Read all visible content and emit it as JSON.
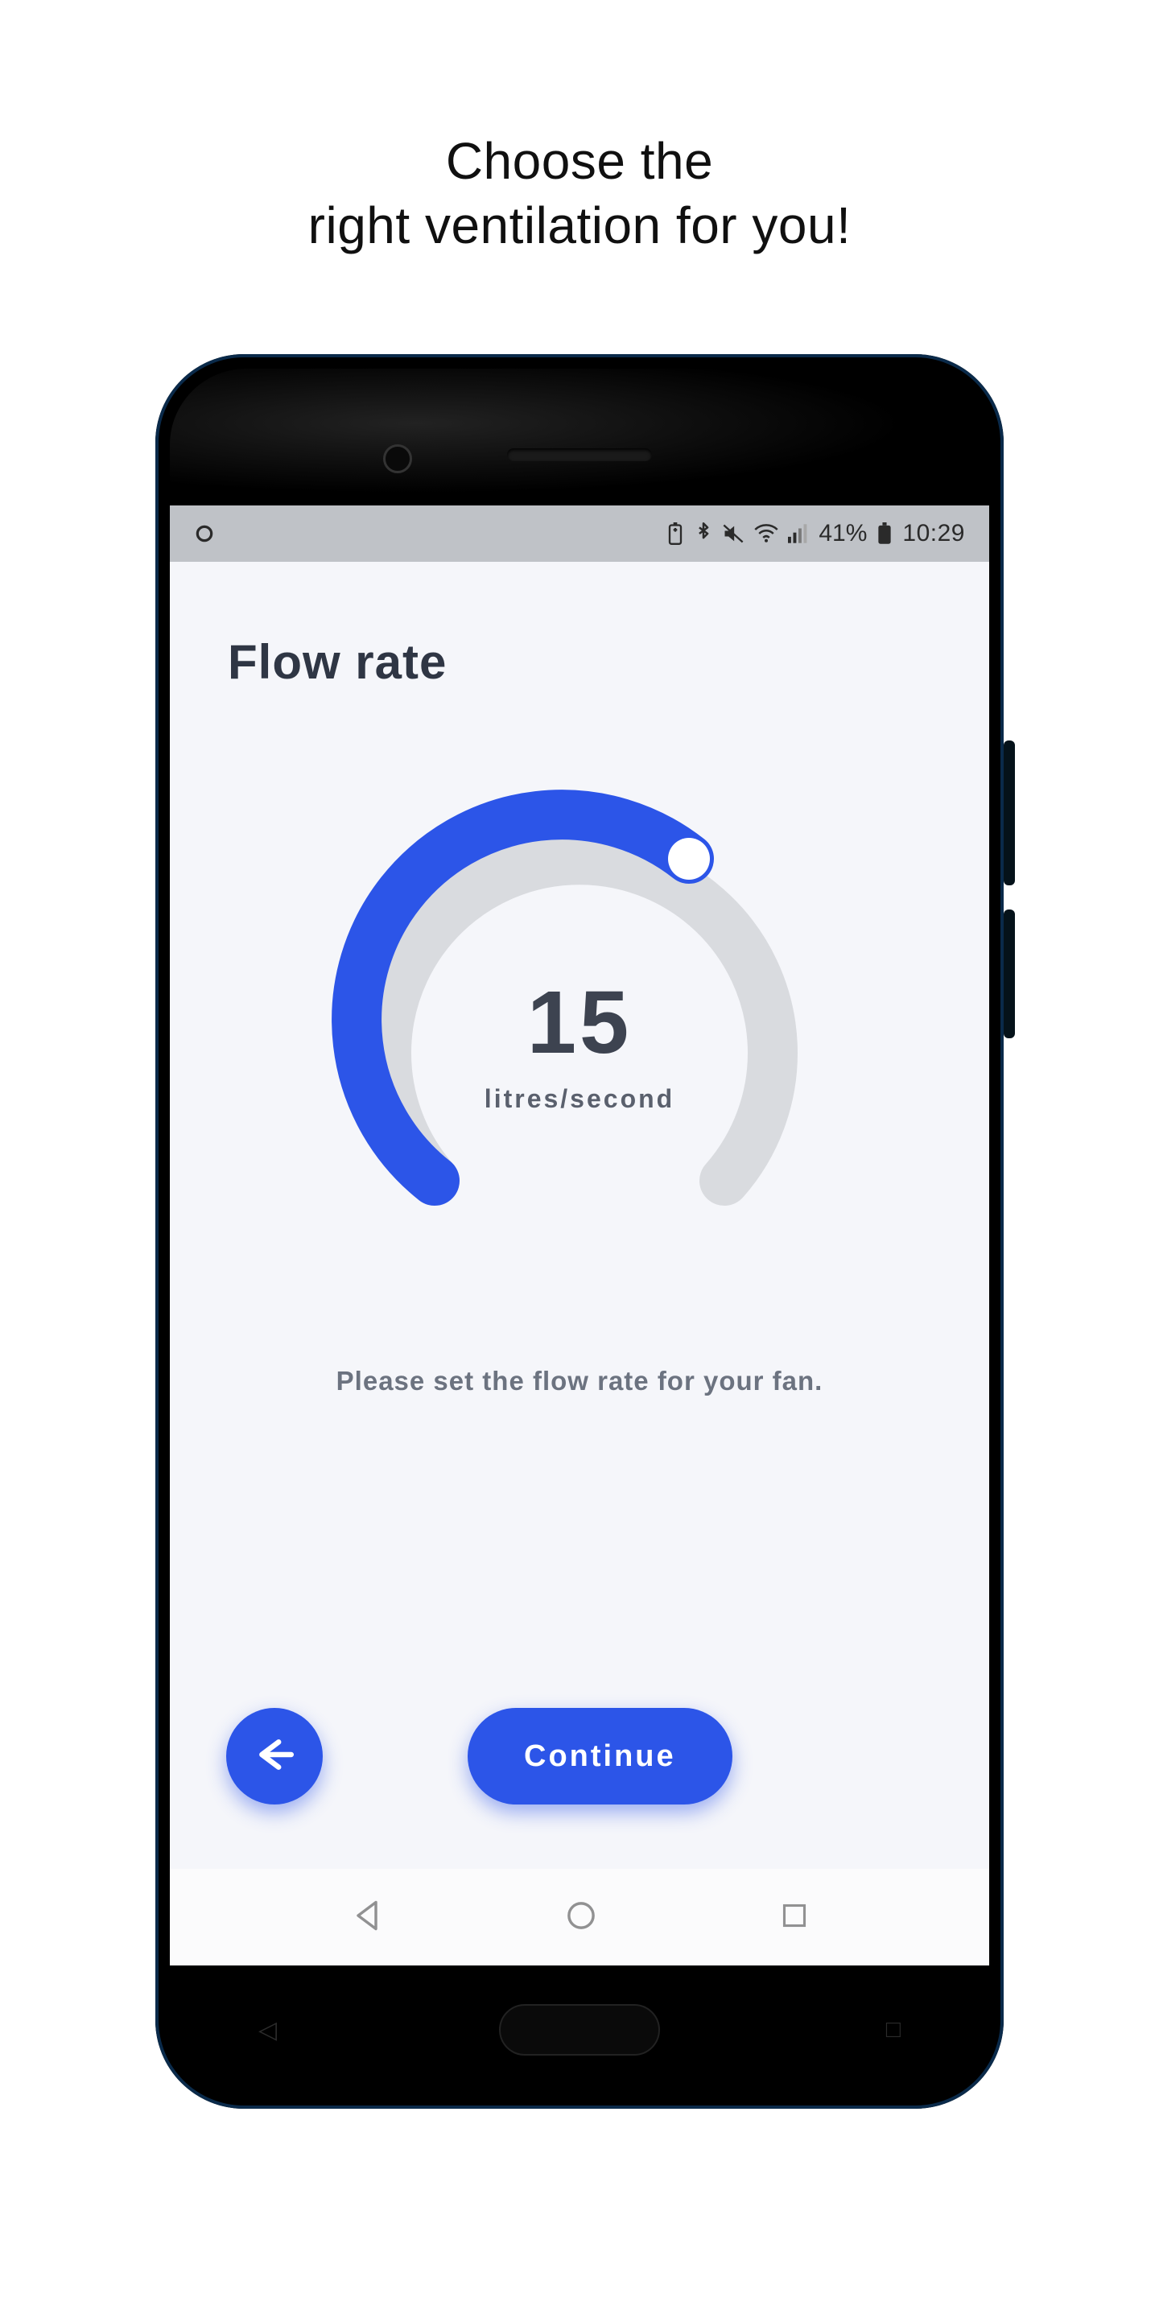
{
  "promo": {
    "line1": "Choose the",
    "line2": "right ventilation for you!"
  },
  "statusbar": {
    "battery_percent": "41%",
    "clock": "10:29"
  },
  "app": {
    "title": "Flow rate",
    "gauge_value": "15",
    "gauge_unit": "litres/second",
    "hint": "Please set the flow rate for your fan.",
    "continue_label": "Continue"
  },
  "colors": {
    "accent": "#2c55e8",
    "track": "#d9dbdf",
    "text_dark": "#2f3644",
    "text_muted": "#6c7380"
  },
  "chart_data": {
    "type": "bar",
    "title": "Flow rate gauge (circular)",
    "xlabel": "",
    "ylabel": "litres/second",
    "ylim": [
      0,
      24
    ],
    "categories": [
      "flow_rate"
    ],
    "values": [
      15
    ],
    "notes": "Semi-circular gauge arc from ~215° to ~-35° (250° sweep). Filled portion ≈ 62% of sweep, thumb at arc end."
  }
}
